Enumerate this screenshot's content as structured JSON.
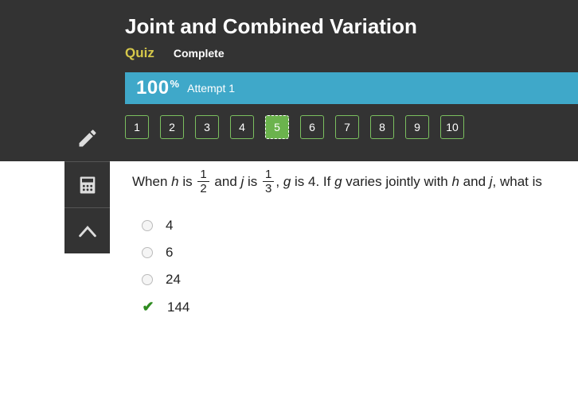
{
  "header": {
    "title": "Joint and Combined Variation",
    "quiz_label": "Quiz",
    "status": "Complete"
  },
  "score": {
    "value": "100",
    "pct": "%",
    "attempt": "Attempt 1"
  },
  "qnav": [
    "1",
    "2",
    "3",
    "4",
    "5",
    "6",
    "7",
    "8",
    "9",
    "10"
  ],
  "active_q": "5",
  "question": {
    "t1": "When ",
    "v1": "h",
    "t2": " is ",
    "f1n": "1",
    "f1d": "2",
    "t3": " and ",
    "v2": "j",
    "t4": " is ",
    "f2n": "1",
    "f2d": "3",
    "t5": ", ",
    "v3": "g",
    "t6": " is 4. If ",
    "v4": "g",
    "t7": " varies jointly with ",
    "v5": "h",
    "t8": " and ",
    "v6": "j",
    "t9": ", what is"
  },
  "answers": [
    {
      "label": "4",
      "correct": false
    },
    {
      "label": "6",
      "correct": false
    },
    {
      "label": "24",
      "correct": false
    },
    {
      "label": "144",
      "correct": true
    }
  ]
}
